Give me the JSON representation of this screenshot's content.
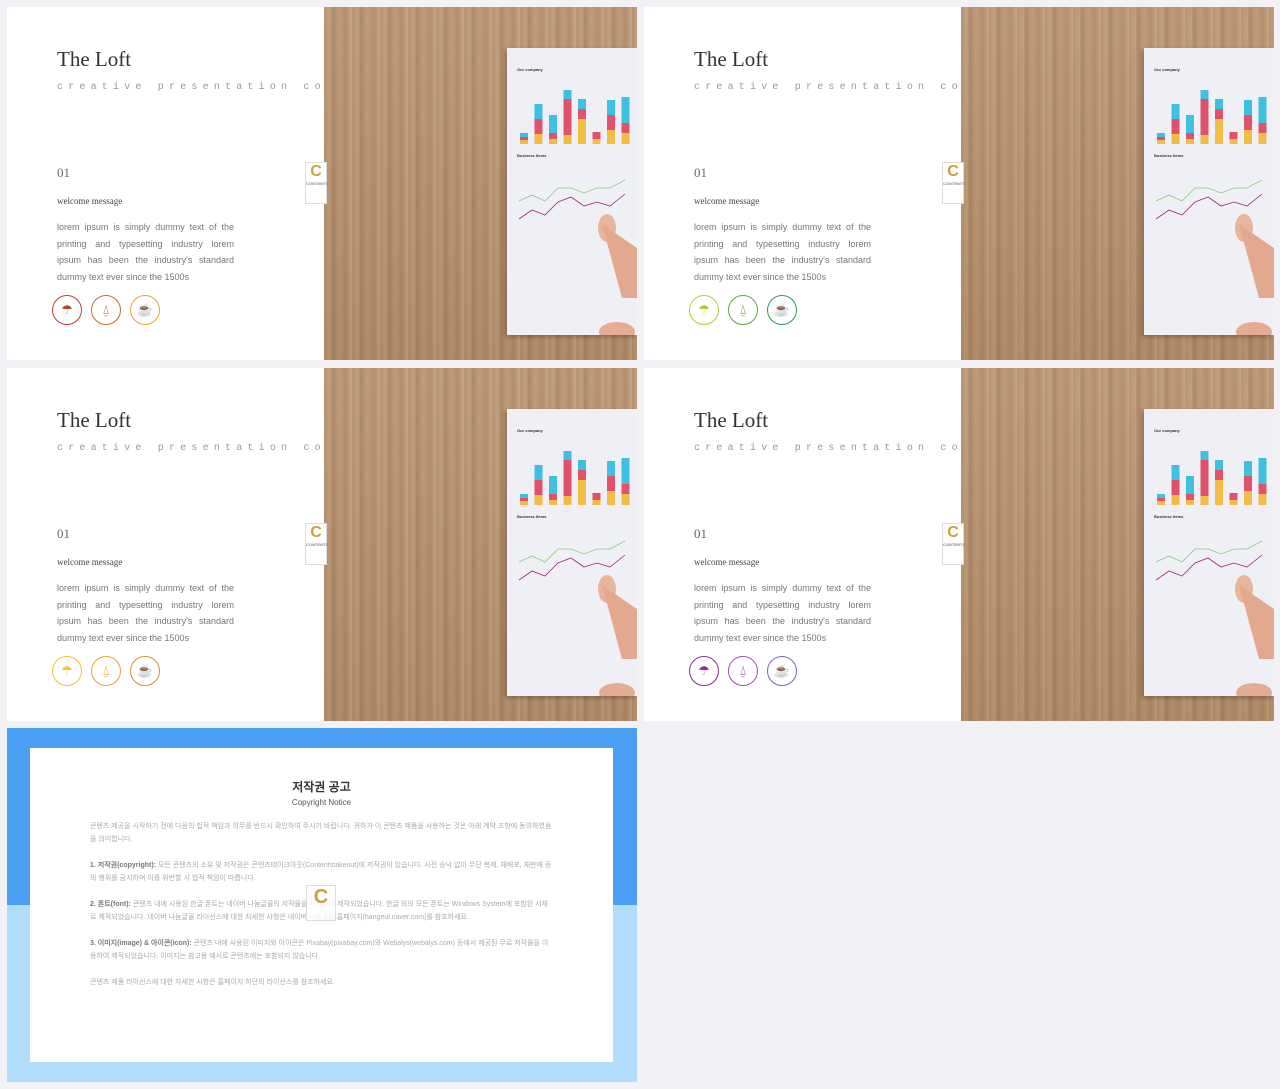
{
  "slides": [
    {
      "title": "The Loft",
      "subtitle": "creative presentation concept",
      "number": "01",
      "heading": "welcome message",
      "body": "lorem ipsum is simply dummy text of the printing and typesetting industry lorem ipsum has been the industry's standard dummy text ever since the 1500s",
      "icon_colors": [
        "#b0432b",
        "#d2642a",
        "#e6a435"
      ]
    },
    {
      "title": "The Loft",
      "subtitle": "creative presentation concept",
      "number": "01",
      "heading": "welcome message",
      "body": "lorem ipsum is simply dummy text of the printing and typesetting industry lorem ipsum has been the industry's standard dummy text ever since the 1500s",
      "icon_colors": [
        "#a6cf3a",
        "#5da63a",
        "#2e9a5a"
      ]
    },
    {
      "title": "The Loft",
      "subtitle": "creative presentation concept",
      "number": "01",
      "heading": "welcome message",
      "body": "lorem ipsum is simply dummy text of the printing and typesetting industry lorem ipsum has been the industry's standard dummy text ever since the 1500s",
      "icon_colors": [
        "#f2c230",
        "#e8a42b",
        "#d88d2c"
      ]
    },
    {
      "title": "The Loft",
      "subtitle": "creative presentation concept",
      "number": "01",
      "heading": "welcome message",
      "body": "lorem ipsum is simply dummy text of the printing and typesetting industry lorem ipsum has been the industry's standard dummy text ever since the 1500s",
      "icon_colors": [
        "#8c2f8c",
        "#9b50b5",
        "#7a60c9"
      ]
    }
  ],
  "icons": [
    "umbrella-icon",
    "hanger-icon",
    "coffee-cup-icon"
  ],
  "paper": {
    "chart1_title": "Our company",
    "chart2_title": "Business Items"
  },
  "logo": "C",
  "copyright": {
    "title": "저작권 공고",
    "subtitle": "Copyright Notice",
    "intro": "콘텐츠 제공을 시작하기 전에 다음의 법적 책임과 의무를 반드시 확인하여 주시기 바랍니다. 귀하가 이 콘텐츠 제품을 사용하는 것은 아래 계약 조항에 동의하였음을 의미합니다.",
    "p1_label": "1. 저작권(copyright):",
    "p1": " 모든 콘텐츠의 소유 및 저작권은 콘텐츠테이크아웃(Contentstakeout)에 저작권이 있습니다. 사전 승낙 없이 무단 복제, 재배포, 재판매 등의 행위를 금지하며 이를 위반할 시 법적 책임이 따릅니다.",
    "p2_label": "2. 폰트(font):",
    "p2": " 콘텐츠 내에 사용된 한글 폰트는 네이버 나눔글꼴의 저작물을 사용하여 제작되었습니다. 한글 외의 모든 폰트는 Windows System에 포함된 서체로 제작되었습니다. 네이버 나눔글꼴 라이선스에 대한 자세한 사항은 네이버 나눔글꼴 홈페이지(hangeul.naver.com)를 참조하세요.",
    "p3_label": "3. 이미지(image) & 아이콘(icon):",
    "p3": " 콘텐츠 내에 사용된 이미지와 아이콘은 Pixabay(pixabay.com)와 Webalys(webalys.com) 등에서 제공된 무료 저작물을 이용하여 제작되었습니다. 이미지는 참고용 예시로 콘텐츠에는 포함되지 않습니다.",
    "outro": "콘텐츠 제품 라이선스에 대한 자세한 사항은 홈페이지 하단의 라이선스를 참조하세요."
  }
}
